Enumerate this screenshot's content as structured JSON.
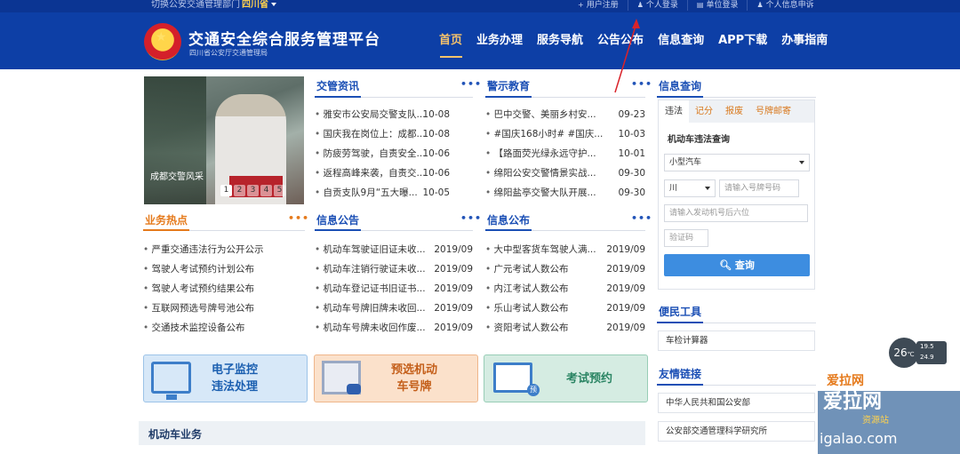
{
  "topbar": {
    "switch_label": "切换公安交通管理部门",
    "province": "四川省",
    "links": [
      "用户注册",
      "个人登录",
      "单位登录",
      "个人信息申诉"
    ]
  },
  "brand": {
    "title": "交通安全综合服务管理平台",
    "subtitle": "四川省公安厅交通管理局"
  },
  "nav": {
    "items": [
      "首页",
      "业务办理",
      "服务导航",
      "公告公布",
      "信息查询",
      "APP下载",
      "办事指南"
    ],
    "active_index": 0
  },
  "photo": {
    "caption": "成都交警风采",
    "pages": [
      "1",
      "2",
      "3",
      "4",
      "5"
    ],
    "current": "1"
  },
  "sections": {
    "jgzx": {
      "title": "交管资讯",
      "more": "•••",
      "items": [
        {
          "text": "雅安市公安局交警支队...",
          "date": "10-08"
        },
        {
          "text": "国庆我在岗位上：成都...",
          "date": "10-08"
        },
        {
          "text": "防疲劳驾驶，自责安全...",
          "date": "10-06"
        },
        {
          "text": "返程高峰来袭，自责交...",
          "date": "10-06"
        },
        {
          "text": "自贡支队9月“五大曝...",
          "date": "10-05"
        }
      ]
    },
    "jsjy": {
      "title": "警示教育",
      "more": "•••",
      "items": [
        {
          "text": "巴中交警、美丽乡村安...",
          "date": "09-23"
        },
        {
          "text": "#国庆168小时# #国庆...",
          "date": "10-03"
        },
        {
          "text": "【路面荧光绿永远守护...",
          "date": "10-01"
        },
        {
          "text": "绵阳公安交警情景实战...",
          "date": "09-30"
        },
        {
          "text": "绵阳盐亭交警大队开展...",
          "date": "09-30"
        }
      ]
    },
    "ywrd": {
      "title": "业务热点",
      "more": "•••",
      "items": [
        {
          "text": "严重交通违法行为公开公示"
        },
        {
          "text": "驾驶人考试预约计划公布"
        },
        {
          "text": "驾驶人考试预约结果公布"
        },
        {
          "text": "互联网预选号牌号池公布"
        },
        {
          "text": "交通技术监控设备公布"
        }
      ]
    },
    "xxgg": {
      "title": "信息公告",
      "more": "•••",
      "items": [
        {
          "text": "机动车驾驶证旧证未收...",
          "date": "2019/09"
        },
        {
          "text": "机动车注销行驶证未收...",
          "date": "2019/09"
        },
        {
          "text": "机动车登记证书旧证书...",
          "date": "2019/09"
        },
        {
          "text": "机动车号牌旧牌未收回...",
          "date": "2019/09"
        },
        {
          "text": "机动车号牌未收回作废...",
          "date": "2019/09"
        }
      ]
    },
    "xxgb": {
      "title": "信息公布",
      "more": "•••",
      "items": [
        {
          "text": "大中型客货车驾驶人满...",
          "date": "2019/09"
        },
        {
          "text": "广元考试人数公布",
          "date": "2019/09"
        },
        {
          "text": "内江考试人数公布",
          "date": "2019/09"
        },
        {
          "text": "乐山考试人数公布",
          "date": "2019/09"
        },
        {
          "text": "资阳考试人数公布",
          "date": "2019/09"
        }
      ]
    }
  },
  "banners": {
    "b1": {
      "line1": "电子监控",
      "line2": "违法处理"
    },
    "b2": {
      "line1": "预选机动",
      "line2": "车号牌"
    },
    "b3": {
      "line1": "考试预约"
    }
  },
  "motor_bar": "机动车业务",
  "query": {
    "title": "信息查询",
    "tabs": [
      "违法",
      "记分",
      "报废",
      "号牌邮寄"
    ],
    "form_title": "机动车违法查询",
    "vehicle_type": "小型汽车",
    "province_prefix": "川",
    "plate_placeholder": "请输入号牌号码",
    "engine_placeholder": "请输入发动机号后六位",
    "captcha_placeholder": "验证码",
    "submit": "查询"
  },
  "tools": {
    "title": "便民工具",
    "items": [
      "车检计算器"
    ]
  },
  "links": {
    "title": "友情链接",
    "items": [
      "中华人民共和国公安部",
      "公安部交通管理科学研究所"
    ]
  },
  "weather": {
    "temp": "26",
    "high": "19.5",
    "low": "24.9"
  },
  "watermark": {
    "l1": "爱拉网",
    "l2": "资源站",
    "l3": "igalao.com"
  }
}
